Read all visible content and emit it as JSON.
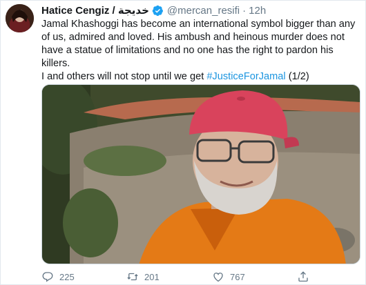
{
  "tweet": {
    "author_name": "Hatice Cengiz / خديجة",
    "handle": "@mercan_resifi",
    "separator": "·",
    "time": "12h",
    "line1": "Jamal Khashoggi has become an international symbol bigger than any of us, admired and loved. His ambush and heinous murder does not have a statue of limitations and no one has the right to pardon his killers.",
    "line2_prefix": "I and others will not stop until we get ",
    "hashtag": "#JusticeForJamal",
    "line2_suffix": " (1/2)"
  },
  "actions": {
    "replies": "225",
    "retweets": "201",
    "likes": "767"
  },
  "colors": {
    "link": "#1b95e0",
    "muted": "#657786",
    "verified": "#1da1f2"
  },
  "icons": [
    "verified-badge-icon",
    "reply-icon",
    "retweet-icon",
    "like-icon",
    "share-icon"
  ]
}
